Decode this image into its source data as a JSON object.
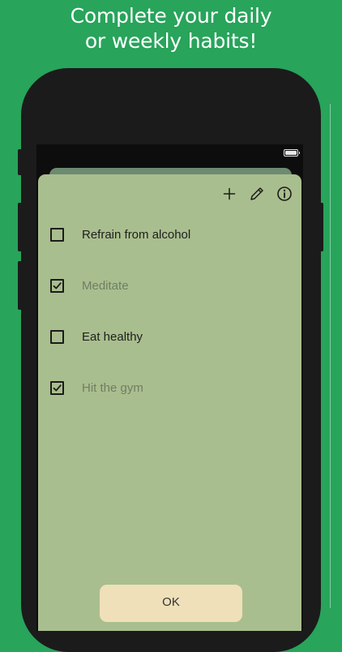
{
  "headline": {
    "line1": "Complete your daily",
    "line2": "or weekly habits!"
  },
  "colors": {
    "background": "#28a45b",
    "sheet": "#a9be8e",
    "ok_button": "#efe0b9",
    "device": "#1b1b1b"
  },
  "toolbar": {
    "icons": [
      "plus-icon",
      "pencil-icon",
      "info-icon"
    ]
  },
  "habits": [
    {
      "label": "Refrain from alcohol",
      "checked": false
    },
    {
      "label": "Meditate",
      "checked": true
    },
    {
      "label": "Eat healthy",
      "checked": false
    },
    {
      "label": "Hit the gym",
      "checked": true
    }
  ],
  "ok_button": {
    "label": "OK"
  }
}
